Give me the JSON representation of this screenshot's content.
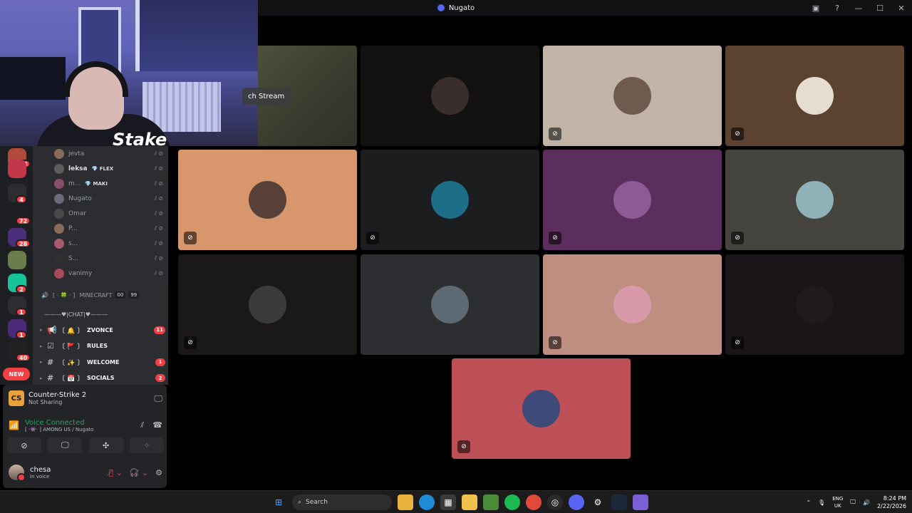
{
  "window": {
    "title": "Nugato"
  },
  "webcam": {
    "overlay_brand": "Stake"
  },
  "servers": [
    {
      "badge": "18",
      "color": "#b04a3c"
    },
    {
      "badge": "",
      "color": "#c4364a"
    },
    {
      "badge": "4",
      "color": "#2b2d31"
    },
    {
      "badge": "72",
      "color": "#1e1f22"
    },
    {
      "badge": "28",
      "color": "#4a2f7a"
    },
    {
      "badge": "",
      "color": "#6b7d4a"
    },
    {
      "badge": "2",
      "color": "#19c39a"
    },
    {
      "badge": "1",
      "color": "#2b2d31"
    },
    {
      "badge": "1",
      "color": "#4b2a7a"
    },
    {
      "badge": "40",
      "color": "#222"
    }
  ],
  "new_badge": "NEW",
  "voice_users": [
    {
      "name": "jevta",
      "tag": "",
      "bold": false,
      "avatar": "#8a6a5a"
    },
    {
      "name": "leksa",
      "tag": "💎 FLEX",
      "bold": true,
      "avatar": "#5c5c5c"
    },
    {
      "name": "m...",
      "tag": "💎 MAKI",
      "bold": false,
      "avatar": "#8a4e6d"
    },
    {
      "name": "Nugato",
      "tag": "",
      "bold": false,
      "avatar": "#6a6a7a"
    },
    {
      "name": "Omar",
      "tag": "",
      "bold": false,
      "avatar": "#4a4a4a"
    },
    {
      "name": "P...",
      "tag": "",
      "bold": false,
      "avatar": "#8a6a5a"
    },
    {
      "name": "s...",
      "tag": "",
      "bold": false,
      "avatar": "#aa5a6a"
    },
    {
      "name": "S...",
      "tag": "",
      "bold": false,
      "avatar": "#303030"
    },
    {
      "name": "vanimy",
      "tag": "",
      "bold": false,
      "avatar": "#aa4a5a"
    }
  ],
  "minecraft_channel": {
    "prefix": "[ · 🍀 · ]",
    "name": "MINECRAFT",
    "count_a": "00",
    "count_b": "99"
  },
  "chat_separator": "———♥|CHAT|♥———",
  "text_channels": [
    {
      "emoji": "〔 🔔 〕",
      "name": "ZVONCE",
      "count": "11",
      "icon": "📢"
    },
    {
      "emoji": "〔 🚩 〕",
      "name": "RULES",
      "count": "",
      "icon": "☑"
    },
    {
      "emoji": "〔 ✨ 〕",
      "name": "WELCOME",
      "count": "1",
      "icon": "#"
    },
    {
      "emoji": "〔 📅 〕",
      "name": "SOCIALS",
      "count": "2",
      "icon": "#"
    }
  ],
  "activity": {
    "game": "Counter-Strike 2",
    "status": "Not Sharing"
  },
  "voice": {
    "title": "Voice Connected",
    "channel": "[ ·👾· ] AMONG US / Nugato"
  },
  "me": {
    "name": "chesa",
    "status": "In voice"
  },
  "stage": {
    "watch_label": "ch Stream",
    "tiles": [
      {
        "bg": "#141211",
        "avatar": "#3a2e2c",
        "cam_off": false
      },
      {
        "bg": "#c1b4a7",
        "avatar": "#6f5a4e",
        "cam_off": true
      },
      {
        "bg": "#5c4230",
        "avatar": "#e6dcd2",
        "cam_off": true
      },
      {
        "bg": "#d8966c",
        "avatar": "#574038",
        "cam_off": true
      },
      {
        "bg": "#1c1d1e",
        "avatar": "#1c6f86",
        "cam_off": true
      },
      {
        "bg": "#5c2e5e",
        "avatar": "#8d5a96",
        "cam_off": true
      },
      {
        "bg": "#46443e",
        "avatar": "#8fb2b8",
        "cam_off": true
      },
      {
        "bg": "#1a1918",
        "avatar": "#3b3b3b",
        "cam_off": true
      },
      {
        "bg": "#2d2e31",
        "avatar": "#5d6a74",
        "cam_off": false
      },
      {
        "bg": "#be8e80",
        "avatar": "#d89aa8",
        "cam_off": true
      },
      {
        "bg": "#1a1519",
        "avatar": "#201a1e",
        "cam_off": true
      },
      {
        "bg": "#be5058",
        "avatar": "#3e4a7a",
        "cam_off": true
      }
    ]
  },
  "taskbar": {
    "search": "Search",
    "lang_top": "ENG",
    "lang_bottom": "UK",
    "time": "8:24 PM",
    "date": "2/22/2026"
  }
}
